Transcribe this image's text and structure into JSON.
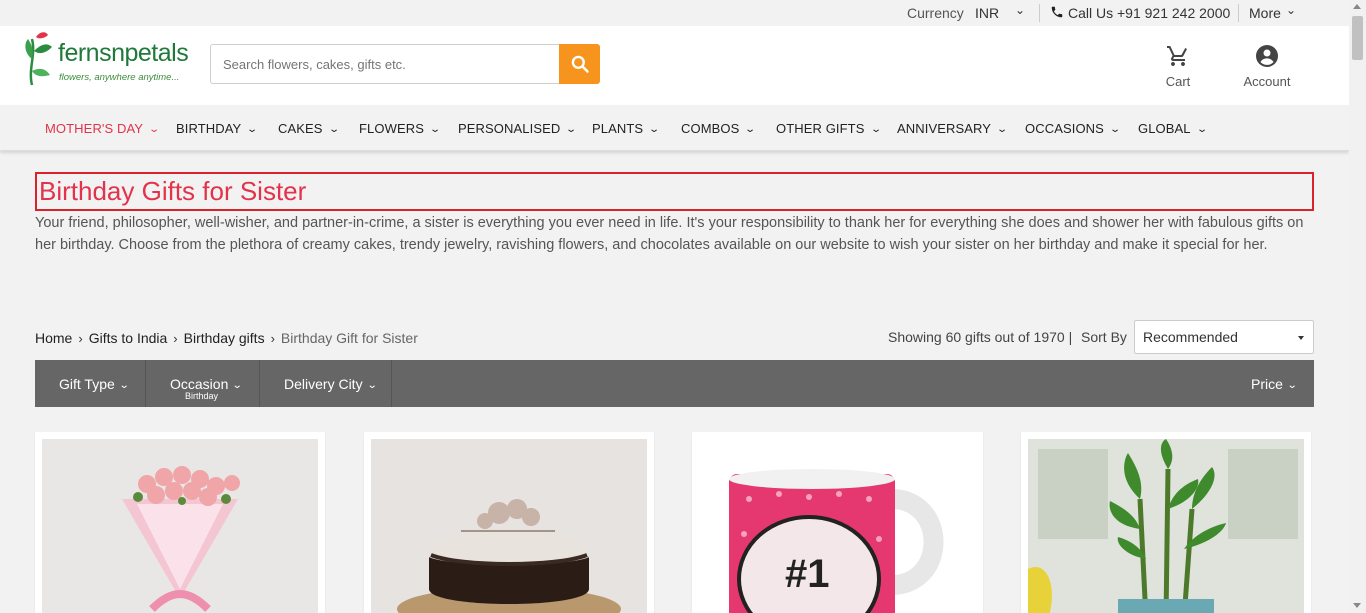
{
  "topbar": {
    "currency_label": "Currency",
    "currency_value": "INR",
    "call_label": "Call Us +91 921 242 2000",
    "more_label": "More"
  },
  "header": {
    "logo_text": "fernsnpetals",
    "logo_tagline": "flowers, anywhere anytime...",
    "search_placeholder": "Search flowers, cakes, gifts etc.",
    "cart_label": "Cart",
    "account_label": "Account"
  },
  "nav": {
    "items": [
      {
        "label": "MOTHER'S DAY"
      },
      {
        "label": "BIRTHDAY"
      },
      {
        "label": "CAKES"
      },
      {
        "label": "FLOWERS"
      },
      {
        "label": "PERSONALISED"
      },
      {
        "label": "PLANTS"
      },
      {
        "label": "COMBOS"
      },
      {
        "label": "OTHER GIFTS"
      },
      {
        "label": "ANNIVERSARY"
      },
      {
        "label": "OCCASIONS"
      },
      {
        "label": "GLOBAL"
      }
    ]
  },
  "page": {
    "title": "Birthday Gifts for Sister",
    "description": "Your friend, philosopher, well-wisher, and partner-in-crime, a sister is everything you ever need in life. It's your responsibility to thank her for everything she does and shower her with fabulous gifts on her birthday. Choose from the plethora of creamy cakes, trendy jewelry, ravishing flowers, and chocolates available on our website to wish your sister on her birthday and make it special for her."
  },
  "breadcrumb": {
    "items": [
      "Home",
      "Gifts to India",
      "Birthday gifts",
      "Birthday Gift for Sister"
    ]
  },
  "listing": {
    "showing_text": "Showing 60 gifts out of 1970 |",
    "sort_label": "Sort By",
    "sort_value": "Recommended"
  },
  "filters": {
    "gift_type": "Gift Type",
    "occasion": "Occasion",
    "occasion_selected": "Birthday",
    "delivery_city": "Delivery City",
    "price": "Price"
  },
  "products": [
    {
      "image": "pink-roses-bouquet"
    },
    {
      "image": "chocolate-truffle-cake"
    },
    {
      "image": "number-1-sister-mug"
    },
    {
      "image": "lucky-bamboo-plant"
    }
  ],
  "colors": {
    "accent_red": "#e2334a",
    "search_orange": "#f7941d",
    "brand_green": "#1f7a3a",
    "filter_bar": "#666666"
  }
}
